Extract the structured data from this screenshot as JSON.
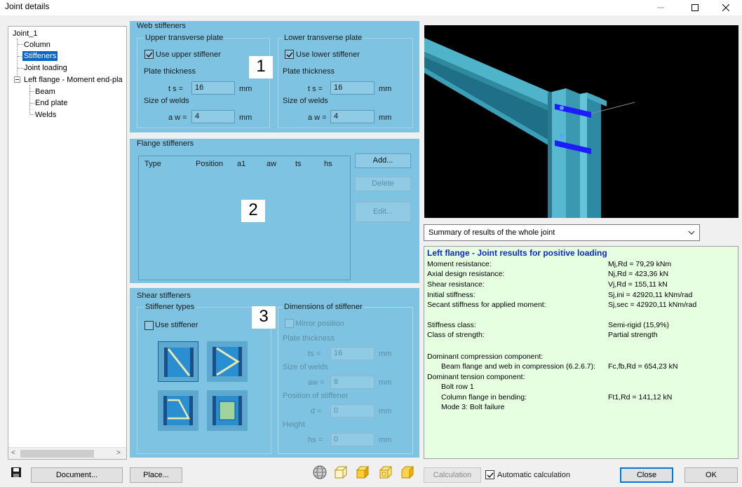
{
  "window": {
    "title": "Joint details"
  },
  "tree": {
    "items": [
      {
        "label": "Joint_1"
      },
      {
        "label": "Column"
      },
      {
        "label": "Stiffeners",
        "selected": true
      },
      {
        "label": "Joint loading"
      },
      {
        "label": "Left flange - Moment end-pla"
      },
      {
        "label": "Beam"
      },
      {
        "label": "End plate"
      },
      {
        "label": "Welds"
      }
    ],
    "scroll_left": "<",
    "scroll_right": ">"
  },
  "web_stiffeners": {
    "title": "Web stiffeners",
    "number": "1",
    "upper": {
      "group_title": "Upper transverse plate",
      "checkbox_label": "Use upper stiffener",
      "checked": true,
      "thickness_label": "Plate thickness",
      "ts_label": "t s =",
      "ts_value": "16",
      "ts_unit": "mm",
      "welds_label": "Size of welds",
      "aw_label": "a w =",
      "aw_value": "4",
      "aw_unit": "mm"
    },
    "lower": {
      "group_title": "Lower transverse plate",
      "checkbox_label": "Use lower stiffener",
      "checked": true,
      "thickness_label": "Plate thickness",
      "ts_label": "t s =",
      "ts_value": "16",
      "ts_unit": "mm",
      "welds_label": "Size of welds",
      "aw_label": "a w =",
      "aw_value": "4",
      "aw_unit": "mm"
    }
  },
  "flange_stiffeners": {
    "title": "Flange stiffeners",
    "number": "2",
    "columns": [
      "Type",
      "Position",
      "a1",
      "aw",
      "ts",
      "hs"
    ],
    "add_label": "Add...",
    "delete_label": "Delete",
    "edit_label": "Edit..."
  },
  "shear_stiffeners": {
    "title": "Shear stiffeners",
    "number": "3",
    "types_title": "Stiffener types",
    "use_label": "Use stiffener",
    "checked": false,
    "dims_title": "Dimensions of stiffener",
    "mirror_label": "Mirror position",
    "thickness_label": "Plate thickness",
    "ts_label": "ts =",
    "ts_value": "16",
    "welds_label": "Size of welds",
    "aw_label": "aw =",
    "aw_value": "8",
    "position_label": "Position of stiffener",
    "d_label": "d =",
    "d_value": "0",
    "height_label": "Height",
    "hs_label": "hs =",
    "hs_value": "0",
    "unit": "mm"
  },
  "summary": {
    "selected": "Summary of results of the whole joint"
  },
  "results": {
    "heading": "Left flange - Joint results for positive loading",
    "rows": [
      {
        "label": "Moment resistance:",
        "value": "Mj,Rd = 79,29 kNm"
      },
      {
        "label": "Axial design resistance:",
        "value": "Nj,Rd = 423,36 kN"
      },
      {
        "label": "Shear resistance:",
        "value": "Vj,Rd = 155,11 kN"
      },
      {
        "label": "Initial stiffness:",
        "value": "Sj,ini = 42920,11 kNm/rad"
      },
      {
        "label": "Secant stiffness for applied moment:",
        "value": "Sj,sec = 42920,11 kNm/rad"
      },
      {
        "label": "Stiffness class:",
        "value": "Semi-rigid (15,9%)"
      },
      {
        "label": "Class of strength:",
        "value": "Partial strength"
      },
      {
        "label": "Dominant compression component:",
        "value": ""
      },
      {
        "label": "Beam flange and web in compression (6.2.6.7):",
        "value": "Fc,fb,Rd = 654,23 kN"
      },
      {
        "label": "Dominant tension component:",
        "value": ""
      },
      {
        "label": "Bolt row 1",
        "value": ""
      },
      {
        "label": "Column flange in bending:",
        "value": "Ft1,Rd = 141,12 kN"
      },
      {
        "label": "Mode 3: Bolt failure",
        "value": ""
      }
    ]
  },
  "bottom": {
    "document_label": "Document...",
    "place_label": "Place...",
    "calculation_label": "Calculation",
    "auto_calc_label": "Automatic calculation",
    "auto_calc_checked": true,
    "close_label": "Close",
    "ok_label": "OK"
  }
}
